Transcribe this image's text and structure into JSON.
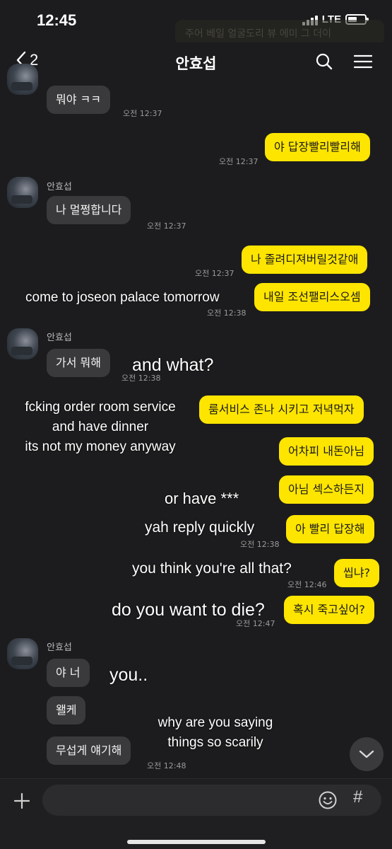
{
  "status_bar": {
    "time": "12:45",
    "network": "LTE"
  },
  "ghost_notification": "주어 베일 얼굴도리 뷰 에미 그 더이",
  "header": {
    "back_count": "2",
    "title": "안효섭"
  },
  "messages": [
    {
      "type": "in",
      "text": "뭐야 ㅋㅋ",
      "time": "오전 12:37"
    },
    {
      "type": "out",
      "text": "야 답장빨리빨리해",
      "time": "오전 12:37"
    },
    {
      "type": "in",
      "sender": "안효섭",
      "text": "나 멀쩡합니다",
      "time": "오전 12:37"
    },
    {
      "type": "out",
      "text": "나 졸려디져버릴것같애",
      "time": "오전 12:37"
    },
    {
      "type": "out",
      "text": "내일 조선팰리스오셈",
      "time": "오전 12:38"
    },
    {
      "type": "in",
      "sender": "안효섭",
      "text": "가서 뭐해",
      "time": "오전 12:38"
    },
    {
      "type": "out",
      "text": "룸서비스 존나 시키고 저녁먹자"
    },
    {
      "type": "out",
      "text": "어차피 내돈아님"
    },
    {
      "type": "out",
      "text": "아님 섹스하든지"
    },
    {
      "type": "out",
      "text": "아 빨리 답장해",
      "time": "오전 12:38"
    },
    {
      "type": "out",
      "text": "씹냐?",
      "time": "오전 12:46"
    },
    {
      "type": "out",
      "text": "혹시 죽고싶어?",
      "time": "오전 12:47"
    },
    {
      "type": "in",
      "sender": "안효섭",
      "text": "야 너"
    },
    {
      "type": "in",
      "text": "왤케"
    },
    {
      "type": "in",
      "text": "무섭게 얘기해",
      "time": "오전 12:48"
    }
  ],
  "translations": {
    "t1": "come to joseon palace tomorrow",
    "t2": "and what?",
    "t3": [
      "fcking order room service",
      "and have dinner",
      "its not my money anyway"
    ],
    "t4": "or have ***",
    "t5": "yah reply quickly",
    "t6": "you think you're all that?",
    "t7": "do you want to die?",
    "t8": "you..",
    "t9": [
      "why are you saying",
      "things so scarily"
    ]
  },
  "input_bar": {
    "hash": "#"
  },
  "colors": {
    "background": "#1c1c1e",
    "incoming_bubble": "#3a3a3c",
    "outgoing_bubble": "#fee500"
  }
}
